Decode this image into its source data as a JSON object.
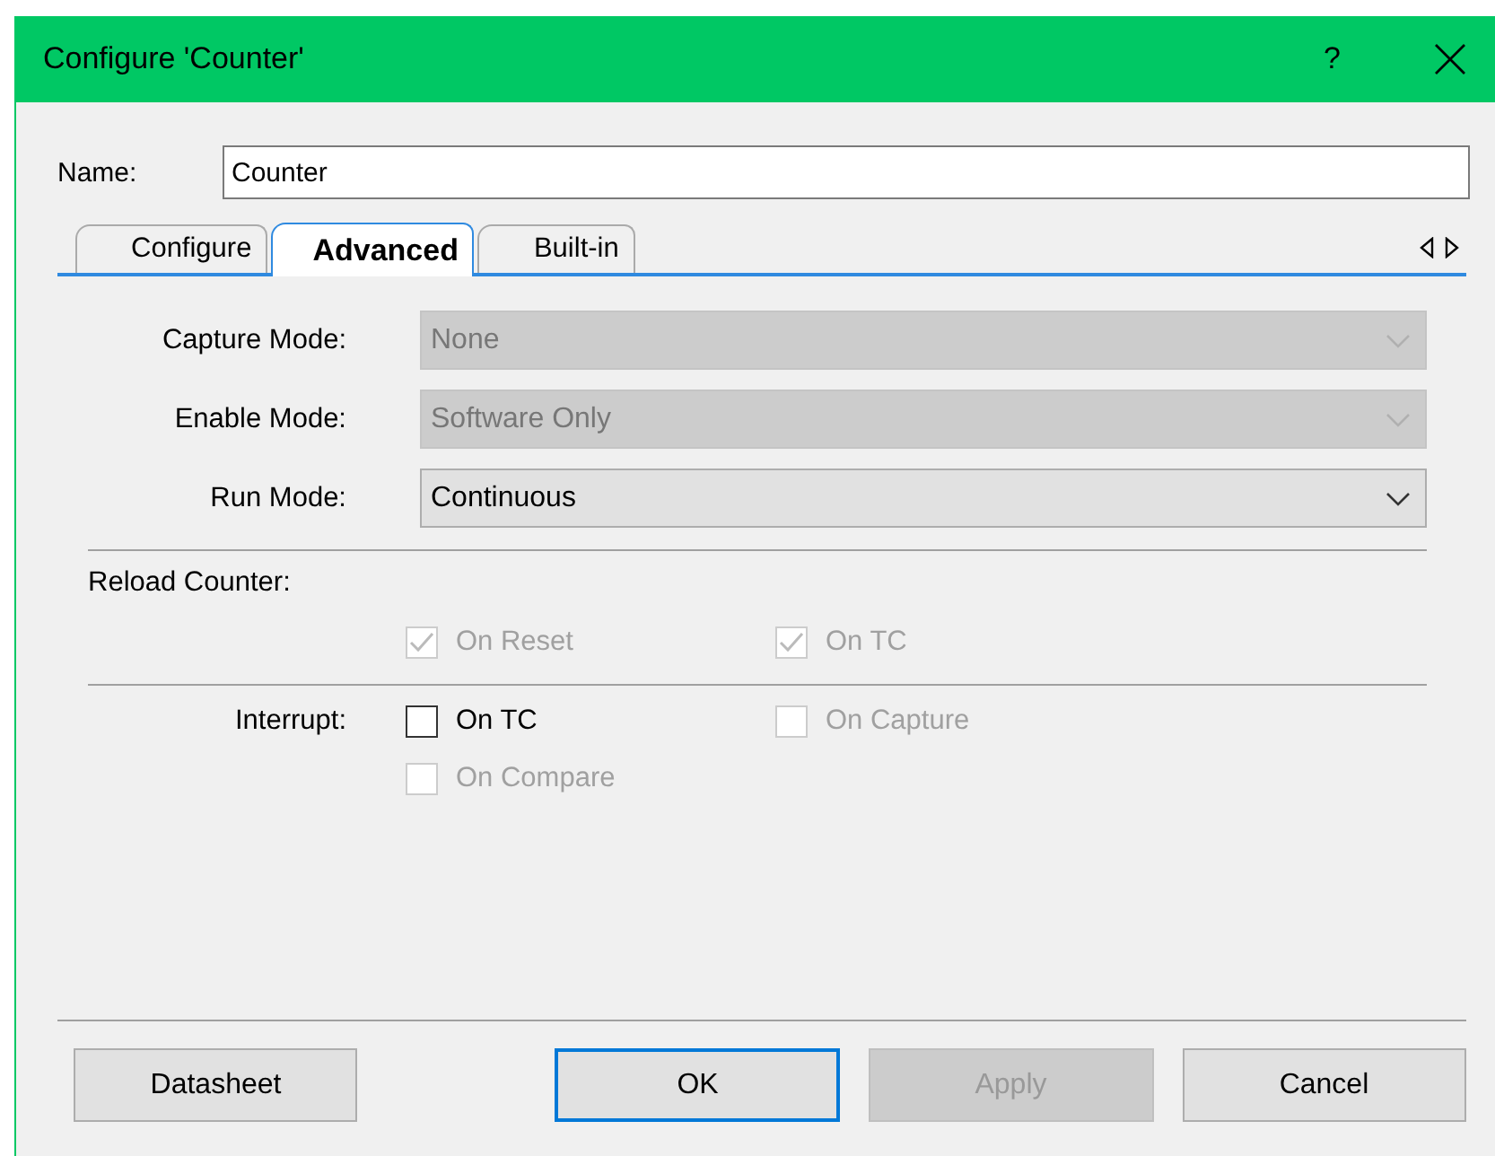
{
  "window": {
    "title": "Configure 'Counter'",
    "help": "?"
  },
  "name_field": {
    "label": "Name:",
    "value": "Counter"
  },
  "tabs": [
    {
      "label": "Configure",
      "selected": false
    },
    {
      "label": "Advanced",
      "selected": true
    },
    {
      "label": "Built-in",
      "selected": false
    }
  ],
  "dropdowns": [
    {
      "label": "Capture Mode:",
      "value": "None",
      "disabled": true
    },
    {
      "label": "Enable Mode:",
      "value": "Software Only",
      "disabled": true
    },
    {
      "label": "Run Mode:",
      "value": "Continuous",
      "disabled": false
    }
  ],
  "reload_counter": {
    "label": "Reload Counter:",
    "options": [
      {
        "label": "On Reset",
        "checked": true,
        "disabled": true
      },
      {
        "label": "On TC",
        "checked": true,
        "disabled": true
      }
    ]
  },
  "interrupt": {
    "label": "Interrupt:",
    "options": [
      {
        "label": "On TC",
        "checked": false,
        "disabled": false
      },
      {
        "label": "On Capture",
        "checked": false,
        "disabled": true
      },
      {
        "label": "On Compare",
        "checked": false,
        "disabled": true
      }
    ]
  },
  "buttons": [
    {
      "label": "Datasheet",
      "disabled": false,
      "default": false
    },
    {
      "label": "OK",
      "disabled": false,
      "default": true
    },
    {
      "label": "Apply",
      "disabled": true,
      "default": false
    },
    {
      "label": "Cancel",
      "disabled": false,
      "default": false
    }
  ]
}
